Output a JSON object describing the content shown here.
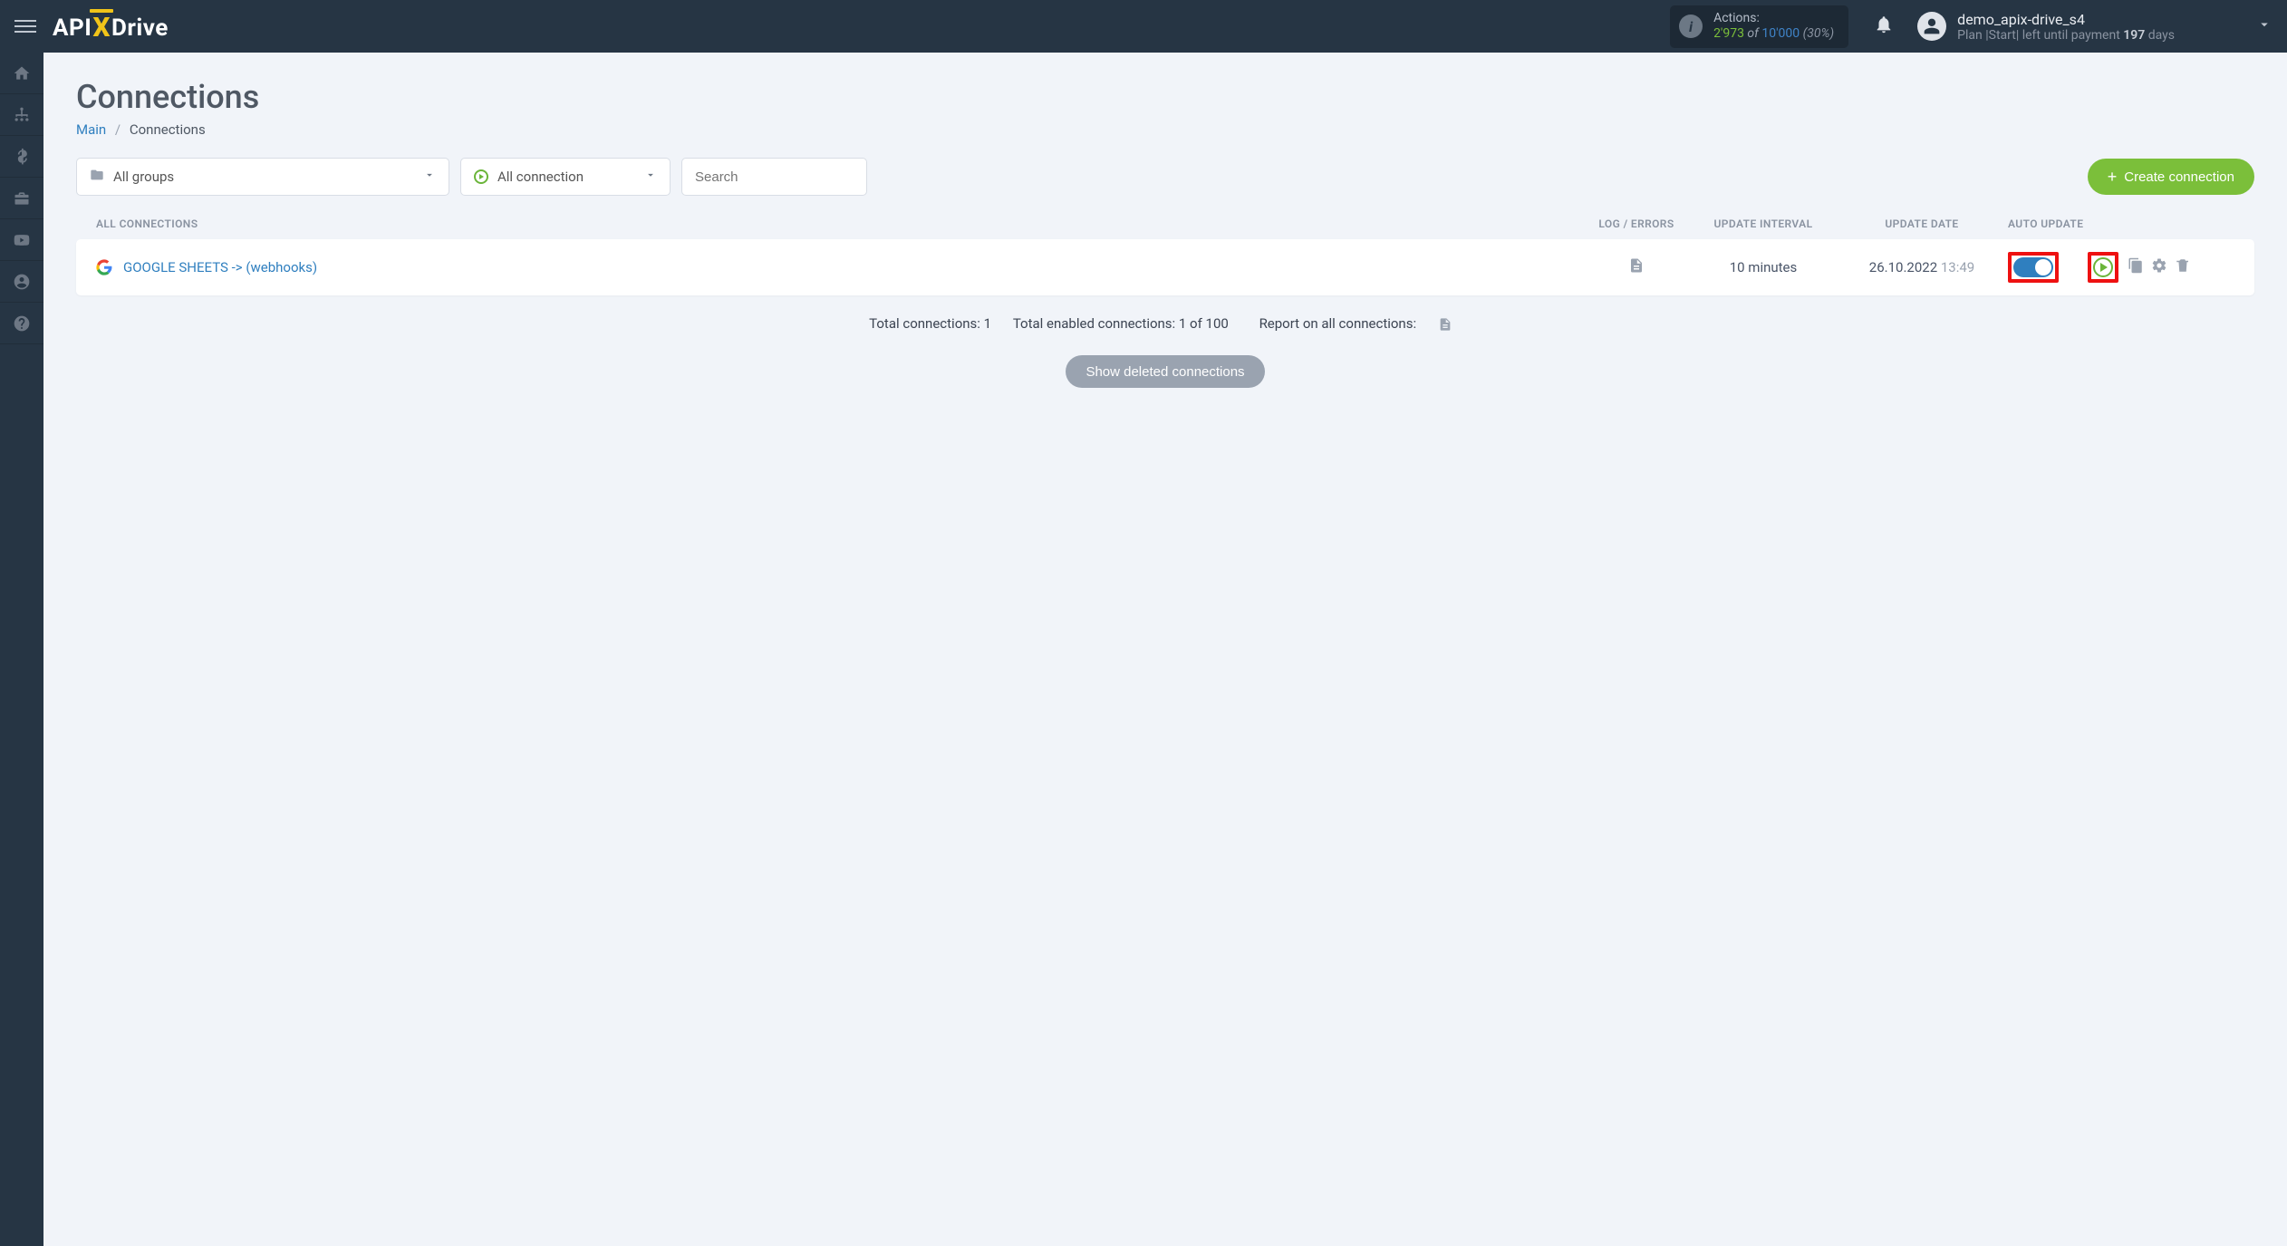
{
  "header": {
    "actions_label": "Actions:",
    "actions_used": "2'973",
    "actions_of": " of ",
    "actions_total": "10'000",
    "actions_pct": " (30%)",
    "username": "demo_apix-drive_s4",
    "plan_prefix": "Plan |Start| left until payment ",
    "plan_days": "197",
    "plan_suffix": " days"
  },
  "page": {
    "title": "Connections",
    "bc_main": "Main",
    "bc_current": "Connections"
  },
  "filters": {
    "groups_label": "All groups",
    "conn_label": "All connection",
    "search_placeholder": "Search",
    "create_label": "Create connection"
  },
  "thead": {
    "name": "ALL CONNECTIONS",
    "log": "LOG / ERRORS",
    "interval": "UPDATE INTERVAL",
    "date": "UPDATE DATE",
    "auto": "AUTO UPDATE"
  },
  "rows": [
    {
      "name": "GOOGLE SHEETS -> (webhooks)",
      "interval": "10 minutes",
      "date": "26.10.2022",
      "time": " 13:49"
    }
  ],
  "footer": {
    "total_conn": "Total connections: 1",
    "total_enabled": "Total enabled connections: 1 of 100",
    "report_label": "Report on all connections:",
    "show_deleted": "Show deleted connections"
  }
}
